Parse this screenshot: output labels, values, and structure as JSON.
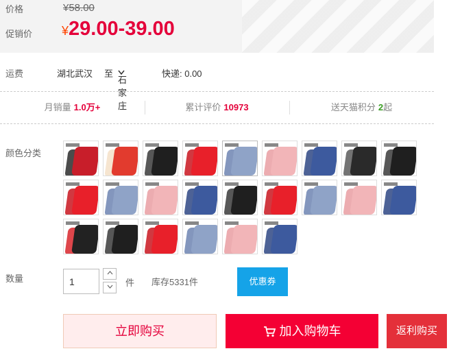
{
  "price": {
    "original_label": "价格",
    "original_value": "¥58.00",
    "promo_label": "促销价",
    "currency": "¥",
    "promo_value": "29.00-39.00"
  },
  "shipping": {
    "label": "运费",
    "from": "湖北武汉",
    "to_word": "至",
    "destination": "石家庄",
    "express": "快递: 0.00",
    "chevron_icon": "chevron-down-icon"
  },
  "stats": {
    "monthly_sales_label": "月销量",
    "monthly_sales_value": "1.0万+",
    "reviews_label": "累计评价",
    "reviews_value": "10973",
    "points_label": "送天猫积分",
    "points_value": "2",
    "points_suffix": "起"
  },
  "color": {
    "label": "颜色分类",
    "swatches": [
      "promo-red",
      "promo-red-2",
      "black",
      "red",
      "blue-gray",
      "pink",
      "navy",
      "black-2",
      "black",
      "red",
      "blue-gray",
      "pink",
      "navy",
      "black",
      "red",
      "blue-gray",
      "pink",
      "navy",
      "black-promo",
      "black",
      "red",
      "blue-gray",
      "pink",
      "navy"
    ]
  },
  "quantity": {
    "label": "数量",
    "value": "1",
    "unit": "件",
    "stock": "库存5331件",
    "coupon_label": "优惠券",
    "up_icon": "chevron-up-icon",
    "down_icon": "chevron-down-icon"
  },
  "actions": {
    "buy_now": "立即购买",
    "add_to_cart": "加入购物车",
    "rebate_buy": "返利购买",
    "cart_icon": "cart-icon"
  },
  "colors": {
    "accent_red": "#e4003a",
    "coupon_blue": "#15a3e8",
    "cart_red": "#f40034"
  }
}
